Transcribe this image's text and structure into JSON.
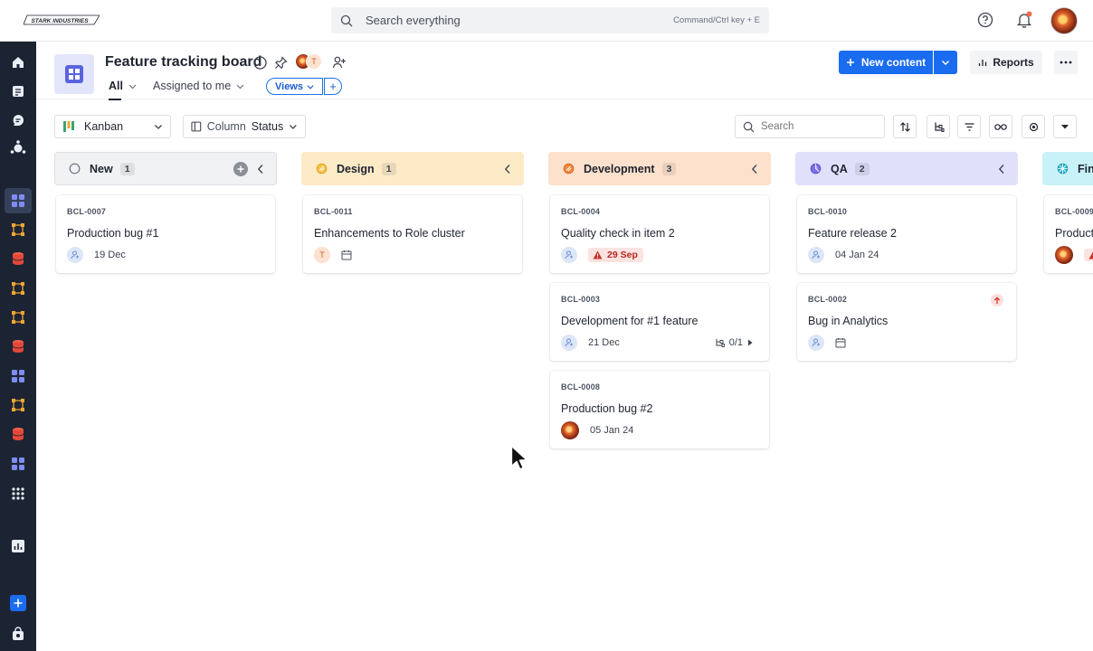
{
  "brand": {
    "logo_text": "STARK INDUSTRIES"
  },
  "search": {
    "placeholder": "Search everything",
    "shortcut_hint": "Command/Ctrl key + E"
  },
  "header": {
    "title": "Feature tracking board",
    "members": [
      {
        "initial": "T"
      }
    ],
    "tabs": [
      {
        "label": "All",
        "active": true
      },
      {
        "label": "Assigned to me",
        "active": false
      }
    ],
    "views_label": "Views",
    "views_add": "+",
    "new_content_label": "New content",
    "reports_label": "Reports"
  },
  "toolbar": {
    "view_mode": "Kanban",
    "column_prefix": "Column",
    "column_value": "Status",
    "search_placeholder": "Search"
  },
  "colors": {
    "primary": "#1a6cf0",
    "new": "#f1f2f4",
    "design": "#fdebc7",
    "development": "#fde1cc",
    "qa": "#e0e0fa",
    "final": "#c8f2f7",
    "late": "#b4261e"
  },
  "columns": [
    {
      "name": "New",
      "count": "1",
      "cards": [
        {
          "id": "BCL-0007",
          "title": "Production bug #1",
          "date": "19 Dec"
        }
      ]
    },
    {
      "name": "Design",
      "count": "1",
      "cards": [
        {
          "id": "BCL-0011",
          "title": "Enhancements to Role cluster",
          "avatar": "T"
        }
      ]
    },
    {
      "name": "Development",
      "count": "3",
      "cards": [
        {
          "id": "BCL-0004",
          "title": "Quality check in item 2",
          "date": "29 Sep",
          "overdue": true
        },
        {
          "id": "BCL-0003",
          "title": "Development for #1 feature",
          "date": "21 Dec",
          "subitems": "0/1"
        },
        {
          "id": "BCL-0008",
          "title": "Production bug #2",
          "date": "05 Jan 24"
        }
      ]
    },
    {
      "name": "QA",
      "count": "2",
      "cards": [
        {
          "id": "BCL-0010",
          "title": "Feature release 2",
          "date": "04 Jan 24"
        },
        {
          "id": "BCL-0002",
          "title": "Bug in Analytics",
          "priority": "high"
        }
      ]
    },
    {
      "name": "Fin",
      "cards": [
        {
          "id": "BCL-0009",
          "title": "Product"
        }
      ]
    }
  ]
}
